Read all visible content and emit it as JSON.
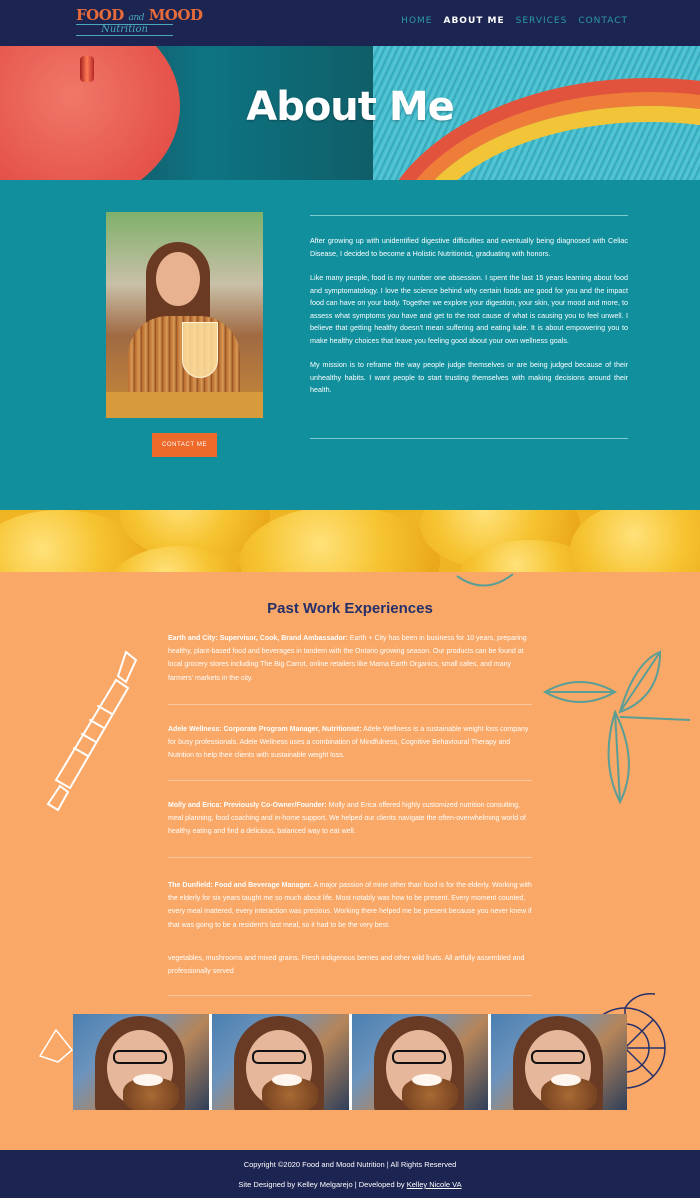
{
  "brand": {
    "logo_line1_a": "FOOD",
    "logo_line1_and": "and",
    "logo_line1_b": "MOOD",
    "logo_line2": "Nutrition"
  },
  "nav": {
    "items": [
      {
        "label": "HOME"
      },
      {
        "label": "ABOUT ME"
      },
      {
        "label": "SERVICES"
      },
      {
        "label": "CONTACT"
      }
    ],
    "active": "ABOUT ME"
  },
  "hero": {
    "title": "About Me"
  },
  "about": {
    "contact_button": "CONTACT ME",
    "paragraphs": [
      "After growing up with unidentified digestive difficulties and eventually being diagnosed with Celiac Disease, I decided to become a Holistic Nutritionist, graduating with honors.",
      "Like many people, food is my number one obsession. I spent the last 15 years learning about food and symptomatology. I love the science behind why certain foods are good for you and the impact food can have on your body. Together we explore your digestion, your skin, your mood and more, to assess what symptoms you have and get to the root cause of what is causing you to feel unwell. I believe that getting healthy doesn't mean suffering and eating kale. It is about empowering you to make healthy choices that leave you feeling good about your own wellness goals.",
      "My mission is to reframe the way people judge themselves or are being judged because of their unhealthy habits. I want people to start trusting themselves with making decisions around their health."
    ]
  },
  "past_work": {
    "title": "Past Work Experiences",
    "items": [
      {
        "heading": "Earth and City: Supervisor, Cook, Brand Ambassador:",
        "text": " Earth + City has been in business for 10 years, preparing healthy, plant-based food and beverages in tandem with the Ontario growing season. Our products can be found at local grocery stores including The Big Carrot, online retailers like Mama Earth Organics, small cafes, and many farmers' markets in the city."
      },
      {
        "heading": "Adele Wellness: Corporate Program Manager, Nutritionist:",
        "text": " Adele Wellness is a sustainable weight loss company for busy professionals. Adele Wellness uses a combination of Mindfulness, Cognitive Behavioural Therapy and Nutrition to help their clients with sustainable weight loss."
      },
      {
        "heading": "Molly and Erica: Previously Co-Owner/Founder:",
        "text": " Molly and Erica offered highly customized nutrition consulting, meal planning, food coaching and in-home support. We helped our clients navigate the often-overwhelming world of healthy eating and find a delicious, balanced way to eat well."
      },
      {
        "heading": "The Dunfield: Food and Beverage Manager.",
        "text": " A major passion of mine other than food is for the elderly. Working with the elderly for six years taught me so much about life. Most notably was how to be present. Every moment counted, every meal mattered, every interaction was precious. Working there helped me be present because you never knew if that was going to be a resident's last meal, so it had to be the very best.",
        "extra": "vegetables, mushrooms and mixed grains. Fresh indigenous berries and other wild fruits. All artfully assembled and professionally served"
      }
    ]
  },
  "footer": {
    "copyright": "Copyright ©2020 Food and Mood Nutrition | All Rights Reserved",
    "credit_prefix": "Site Designed by Kelley Melgarejo | Developed by ",
    "credit_link": "Kelley Nicole VA"
  },
  "colors": {
    "navy": "#1c2452",
    "teal": "#118f9d",
    "orange": "#f9a867",
    "accent": "#ee6a2b"
  }
}
